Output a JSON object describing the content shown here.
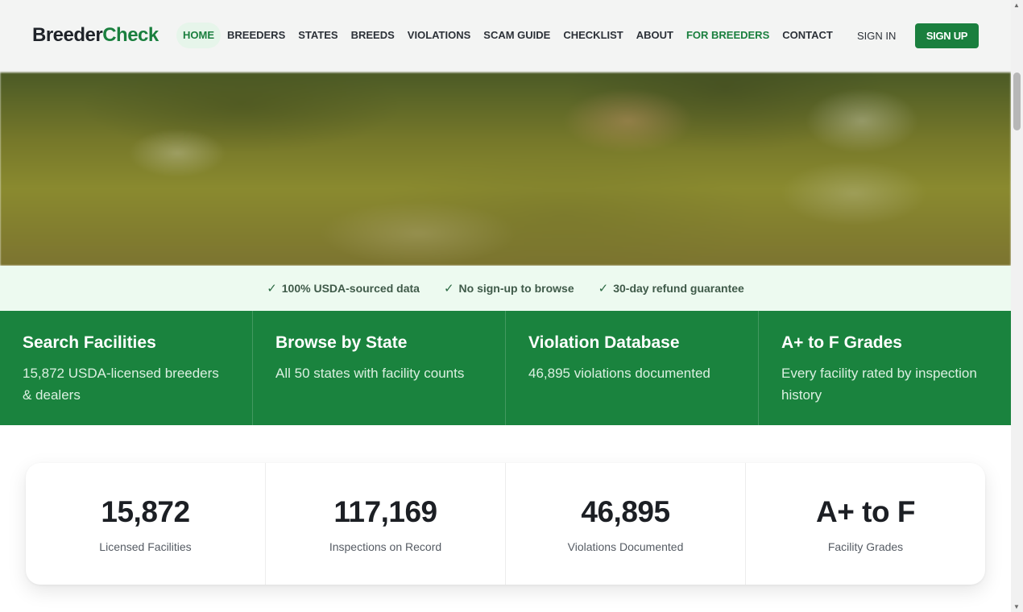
{
  "brand": {
    "part1": "Breeder",
    "part2": "Check"
  },
  "nav": [
    {
      "label": "HOME",
      "state": "active"
    },
    {
      "label": "BREEDERS"
    },
    {
      "label": "STATES"
    },
    {
      "label": "BREEDS"
    },
    {
      "label": "VIOLATIONS"
    },
    {
      "label": "SCAM GUIDE"
    },
    {
      "label": "CHECKLIST"
    },
    {
      "label": "ABOUT"
    },
    {
      "label": "FOR BREEDERS",
      "state": "highlight"
    },
    {
      "label": "CONTACT"
    }
  ],
  "auth": {
    "signin": "SIGN IN",
    "signup": "SIGN UP"
  },
  "trust": [
    {
      "icon": "checkmark-icon",
      "mark": "✓",
      "text": "100% USDA-sourced data"
    },
    {
      "icon": "checkmark-icon",
      "mark": "✓",
      "text": "No sign-up to browse"
    },
    {
      "icon": "checkmark-icon",
      "mark": "✓",
      "text": "30-day refund guarantee"
    }
  ],
  "features": [
    {
      "title": "Search Facilities",
      "desc": "15,872 USDA-licensed breeders & dealers"
    },
    {
      "title": "Browse by State",
      "desc": "All 50 states with facility counts"
    },
    {
      "title": "Violation Database",
      "desc": "46,895 violations documented"
    },
    {
      "title": "A+ to F Grades",
      "desc": "Every facility rated by inspection history"
    }
  ],
  "stats": [
    {
      "value": "15,872",
      "label": "Licensed Facilities"
    },
    {
      "value": "117,169",
      "label": "Inspections on Record"
    },
    {
      "value": "46,895",
      "label": "Violations Documented"
    },
    {
      "value": "A+ to F",
      "label": "Facility Grades"
    }
  ],
  "colors": {
    "brand_green": "#1a7f3e",
    "feature_bg": "#1a833e",
    "trust_bg": "#edfaf0"
  }
}
